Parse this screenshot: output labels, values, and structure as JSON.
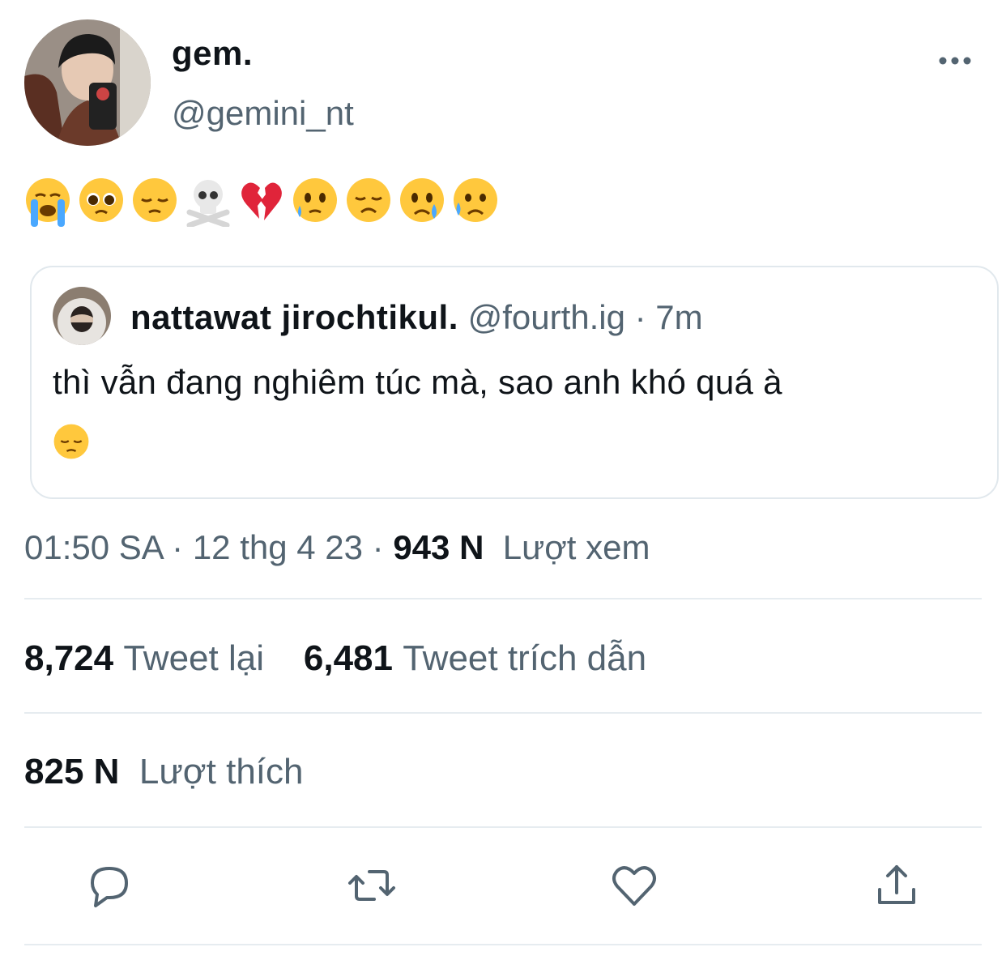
{
  "author": {
    "display_name": "gem.",
    "handle": "@gemini_nt"
  },
  "tweet": {
    "emojis": [
      "loudly-crying-face",
      "pleading-face",
      "pensive-face",
      "skull-and-crossbones",
      "broken-heart",
      "face-holding-back-tears",
      "disappointed-face",
      "crying-face",
      "sad-but-relieved-face"
    ]
  },
  "quote": {
    "name": "nattawat jirochtikul.",
    "handle": "@fourth.ig",
    "separator": " · ",
    "time": "7m",
    "text": "thì vẫn đang nghiêm túc mà, sao anh khó quá à",
    "emoji": "pensive-face"
  },
  "meta": {
    "time": "01:50 SA",
    "dot1": " · ",
    "date": "12 thg 4 23",
    "dot2": " · ",
    "views_count": "943 N",
    "views_label": "Lượt xem"
  },
  "stats": {
    "retweets_count": "8,724",
    "retweets_label": "Tweet lại",
    "quotes_count": "6,481",
    "quotes_label": "Tweet trích dẫn",
    "likes_count": "825 N",
    "likes_label": "Lượt thích"
  },
  "actions": [
    "reply-icon",
    "retweet-icon",
    "like-icon",
    "share-icon"
  ],
  "colors": {
    "text": "#0f1419",
    "secondary": "#536471",
    "border": "#e1e8ed",
    "emoji_yellow": "#ffc83d"
  }
}
